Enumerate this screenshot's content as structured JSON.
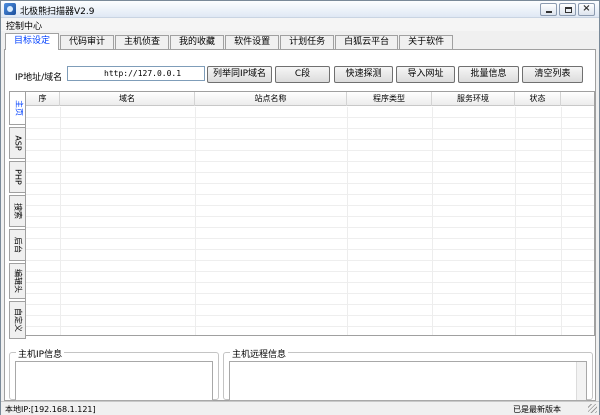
{
  "window": {
    "title": "北极熊扫描器V2.9"
  },
  "menu": {
    "items": [
      "控制中心"
    ]
  },
  "tabs": [
    "目标设定",
    "代码审计",
    "主机侦查",
    "我的收藏",
    "软件设置",
    "计划任务",
    "白狐云平台",
    "关于软件"
  ],
  "active_tab": 0,
  "toolbar": {
    "ip_label": "IP地址/域名",
    "ip_value": "http://127.0.0.1",
    "buttons": [
      "列举同IP域名",
      "C段",
      "快速探测",
      "导入网址",
      "批量信息",
      "清空列表"
    ]
  },
  "side_tabs": [
    "主页",
    "ASP",
    "PHP",
    "搜索",
    "后台",
    "编辑头",
    "自定义"
  ],
  "active_side_tab": 0,
  "grid": {
    "columns": [
      "序",
      "域名",
      "站点名称",
      "程序类型",
      "服务环境",
      "状态"
    ]
  },
  "groups": {
    "host_ip_info": "主机IP信息",
    "host_remote_info": "主机远程信息"
  },
  "status": {
    "local_ip": "本地IP:[192.168.1.121]",
    "version_status": "已是最新版本"
  },
  "colors": {
    "active_tab_text": "#0040ff",
    "border": "#a0a0a0"
  }
}
